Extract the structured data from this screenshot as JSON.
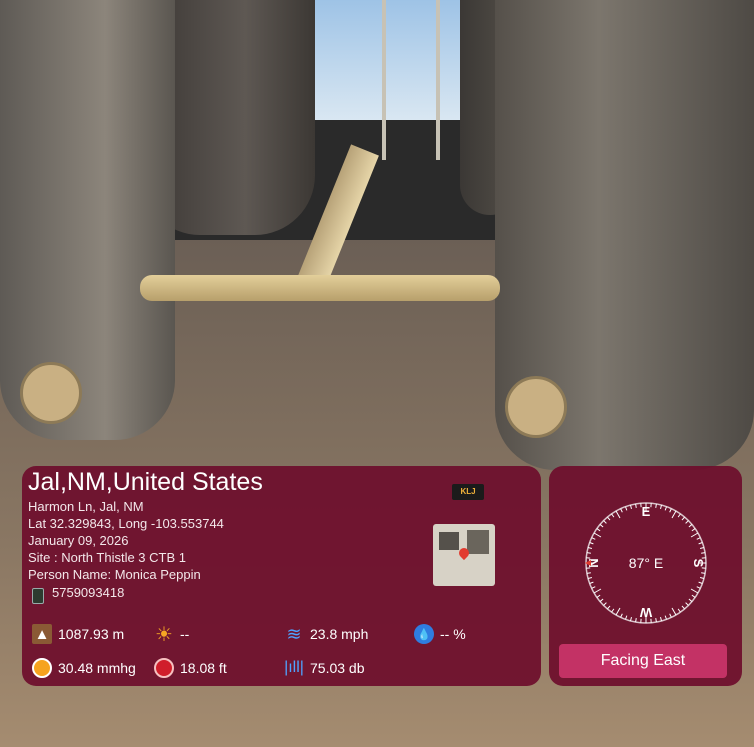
{
  "location": {
    "title": "Jal,NM,United States",
    "address": "Harmon Ln, Jal, NM",
    "coordinates": "Lat 32.329843, Long -103.553744",
    "date": "January 09, 2026",
    "site": "Site : North Thistle 3 CTB 1",
    "person": "Person Name: Monica Peppin",
    "phone": "5759093418",
    "logo_text": "KLJ"
  },
  "stats": {
    "altitude": "1087.93 m",
    "weather": "--",
    "wind": "23.8 mph",
    "humidity": "-- %",
    "pressure": "30.48 mmhg",
    "depth": "18.08 ft",
    "sound": "75.03 db"
  },
  "compass": {
    "heading_label": "87° E",
    "heading_degrees": 87,
    "cardinals": [
      "N",
      "E",
      "S",
      "W"
    ],
    "facing_label": "Facing East"
  },
  "colors": {
    "panel": "#6e0e2c",
    "facing_button": "#c33265"
  },
  "icons": {
    "altitude": "mountain-icon",
    "weather": "sun-icon",
    "wind": "wind-icon",
    "humidity": "humidity-icon",
    "pressure": "gauge-icon",
    "depth": "depth-icon",
    "sound": "sound-wave-icon",
    "phone": "phone-icon"
  }
}
